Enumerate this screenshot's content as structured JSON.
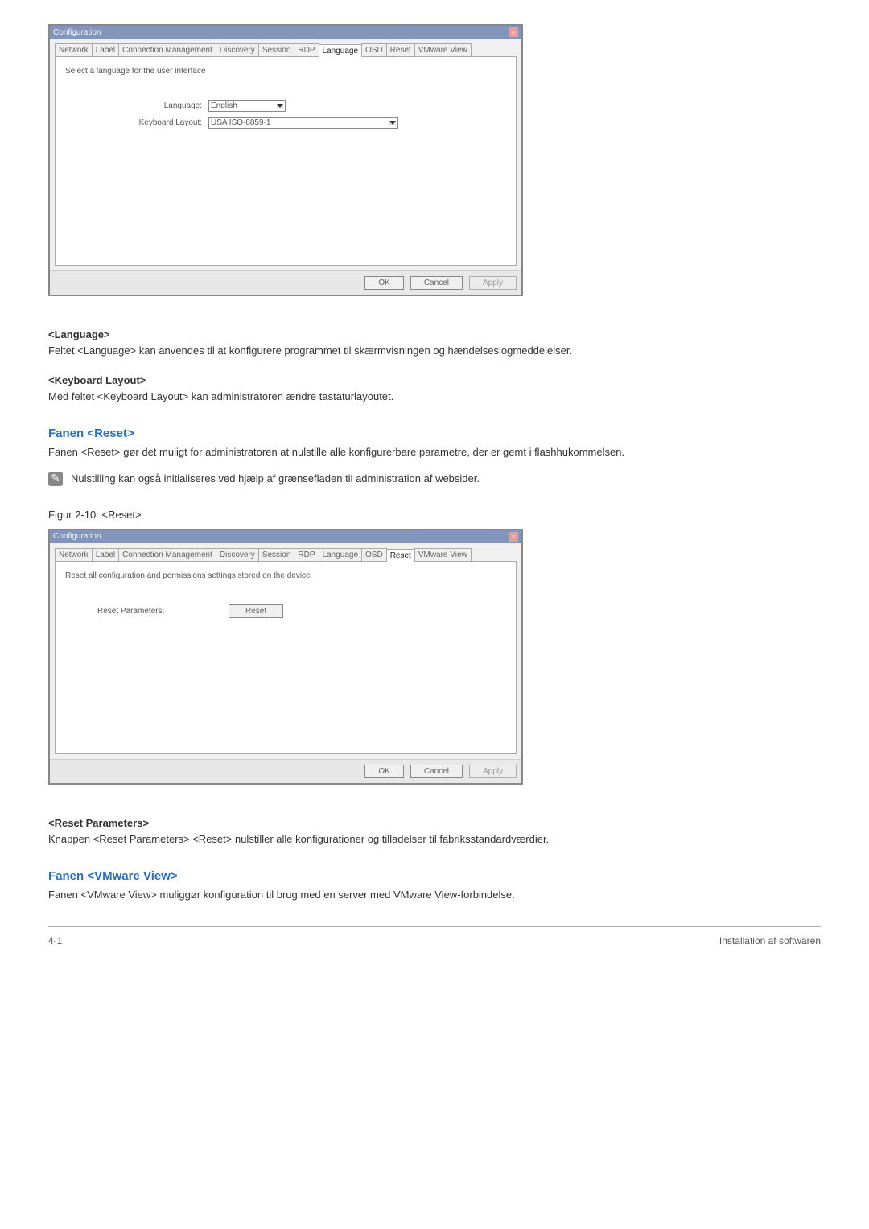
{
  "dialog1": {
    "title": "Configuration",
    "tabs": [
      "Network",
      "Label",
      "Connection Management",
      "Discovery",
      "Session",
      "RDP",
      "Language",
      "OSD",
      "Reset",
      "VMware View"
    ],
    "active_tab": "Language",
    "instruction": "Select a language for the user interface",
    "language_label": "Language:",
    "language_value": "English",
    "keyboard_label": "Keyboard Layout:",
    "keyboard_value": "USA ISO-8859-1",
    "ok": "OK",
    "cancel": "Cancel",
    "apply": "Apply"
  },
  "sections": {
    "language_h": "<Language>",
    "language_p": "Feltet <Language> kan anvendes til at konfigurere programmet til skærmvisningen og hændelseslogmeddelelser.",
    "keyboard_h": "<Keyboard Layout>",
    "keyboard_p": "Med feltet <Keyboard Layout> kan administratoren ændre tastaturlayoutet.",
    "reset_h": "Fanen <Reset>",
    "reset_p": "Fanen <Reset> gør det muligt for administratoren at nulstille alle konfigurerbare parametre, der er gemt i flashhukommelsen.",
    "note": "Nulstilling kan også initialiseres ved hjælp af grænsefladen til administration af websider.",
    "caption2": "Figur 2-10: <Reset>"
  },
  "dialog2": {
    "title": "Configuration",
    "tabs": [
      "Network",
      "Label",
      "Connection Management",
      "Discovery",
      "Session",
      "RDP",
      "Language",
      "OSD",
      "Reset",
      "VMware View"
    ],
    "active_tab": "Reset",
    "instruction": "Reset all configuration and permissions settings stored on the device",
    "reset_params_label": "Reset Parameters:",
    "reset_btn": "Reset",
    "ok": "OK",
    "cancel": "Cancel",
    "apply": "Apply"
  },
  "sections2": {
    "resetparams_h": "<Reset Parameters>",
    "resetparams_p": "Knappen <Reset Parameters> <Reset> nulstiller alle konfigurationer og tilladelser til fabriksstandardværdier.",
    "vmware_h": "Fanen <VMware View>",
    "vmware_p": "Fanen <VMware View> muliggør konfiguration til brug med en server med VMware View-forbindelse."
  },
  "footer": {
    "left": "4-1",
    "right": "Installation af softwaren"
  }
}
